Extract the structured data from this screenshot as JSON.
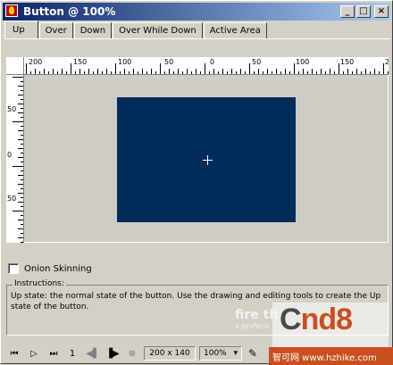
{
  "window": {
    "title": "Button @ 100%",
    "controls": {
      "minimize": "_",
      "maximize": "□",
      "close": "×"
    }
  },
  "tabs": [
    {
      "label": "Up",
      "active": true
    },
    {
      "label": "Over",
      "active": false
    },
    {
      "label": "Down",
      "active": false
    },
    {
      "label": "Over While Down",
      "active": false
    },
    {
      "label": "Active Area",
      "active": false
    }
  ],
  "rulers": {
    "horizontal_labels": [
      "200",
      "150",
      "100",
      "50",
      "0",
      "50",
      "100",
      "150",
      "200"
    ],
    "vertical_labels": [
      "50",
      "0",
      "50"
    ]
  },
  "canvas": {
    "fill_color": "#002d5c"
  },
  "onion": {
    "label": "Onion Skinning",
    "checked": false
  },
  "instructions": {
    "title": "Instructions:",
    "text": "Up state: the normal state of the button. Use the drawing and editing tools to create the Up state of the button."
  },
  "playback": {
    "frame": "1",
    "size": "200 x 140",
    "zoom": "100%",
    "icons": [
      "first-frame-icon",
      "play-icon",
      "last-frame-icon",
      "prev-frame-icon",
      "next-frame-icon",
      "stop-icon",
      "pencil-icon"
    ]
  },
  "watermark": {
    "fire": "fire th",
    "fire_sub": "a professi",
    "cnd8_c": "C",
    "cnd8_rest": "nd8",
    "bar": "智可网  www.hzhike.com"
  }
}
